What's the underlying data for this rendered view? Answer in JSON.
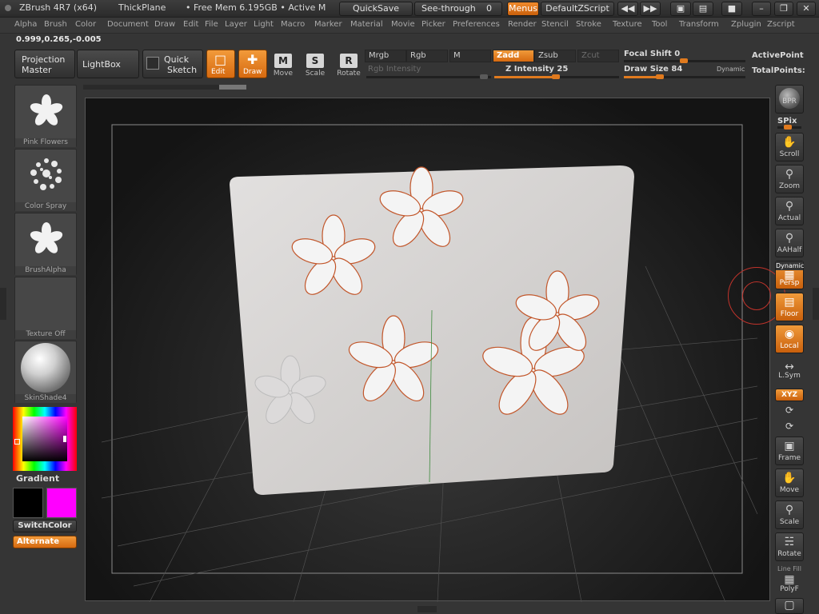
{
  "titlebar": {
    "app_title": "ZBrush 4R7 (x64)",
    "document": "ThickPlane",
    "memory": "• Free Mem 6.195GB • Active M",
    "quicksave": "QuickSave",
    "see_through_label": "See-through",
    "see_through_value": "0",
    "menus": "Menus",
    "script": "DefaultZScript"
  },
  "menubar": [
    "Alpha",
    "Brush",
    "Color",
    "Document",
    "Draw",
    "Edit",
    "File",
    "Layer",
    "Light",
    "Macro",
    "Marker",
    "Material",
    "Movie",
    "Picker",
    "Preferences",
    "Render",
    "Stencil",
    "Stroke",
    "Texture",
    "Tool",
    "Transform",
    "Zplugin",
    "Zscript"
  ],
  "shelf": {
    "coords": "0.999,0.265,-0.005",
    "projection_master": [
      "Projection",
      "Master"
    ],
    "lightbox": "LightBox",
    "quick_sketch": [
      "Quick",
      "Sketch"
    ],
    "edit": "Edit",
    "draw": "Draw",
    "move": "Move",
    "scale": "Scale",
    "rotate": "Rotate",
    "move_letter": "M",
    "scale_letter": "S",
    "rotate_letter": "R",
    "mrgb": "Mrgb",
    "rgb": "Rgb",
    "m": "M",
    "rgb_intensity": "Rgb Intensity",
    "zadd": "Zadd",
    "zsub": "Zsub",
    "zcut": "Zcut",
    "z_intensity": "Z Intensity 25",
    "z_intensity_value": 25,
    "focal_shift": "Focal Shift 0",
    "draw_size": "Draw Size 84",
    "draw_size_value": 84,
    "dynamic": "Dynamic",
    "active_points": "ActivePoint",
    "total_points": "TotalPoints:"
  },
  "left_tray": {
    "brush": "Pink Flowers",
    "stroke": "Color Spray",
    "alpha": "BrushAlpha",
    "texture": "Texture Off",
    "material": "SkinShade4",
    "gradient": "Gradient",
    "switch_color": "SwitchColor",
    "alternate": "Alternate",
    "primary_color": "#000000",
    "secondary_color": "#ff00ff"
  },
  "right_tray": {
    "bpr": "BPR",
    "spix": "SPix",
    "scroll": "Scroll",
    "zoom": "Zoom",
    "actual": "Actual",
    "aahalf": "AAHalf",
    "dynamic": "Dynamic",
    "persp": "Persp",
    "floor": "Floor",
    "local": "Local",
    "lsym": "L.Sym",
    "xyz": "XYZ",
    "frame": "Frame",
    "move": "Move",
    "scale": "Scale",
    "rotate": "Rotate",
    "line_fill": "Line Fill",
    "polyf": "PolyF"
  },
  "colors": {
    "accent": "#e8801f",
    "panel": "#353535",
    "button": "#444444"
  }
}
